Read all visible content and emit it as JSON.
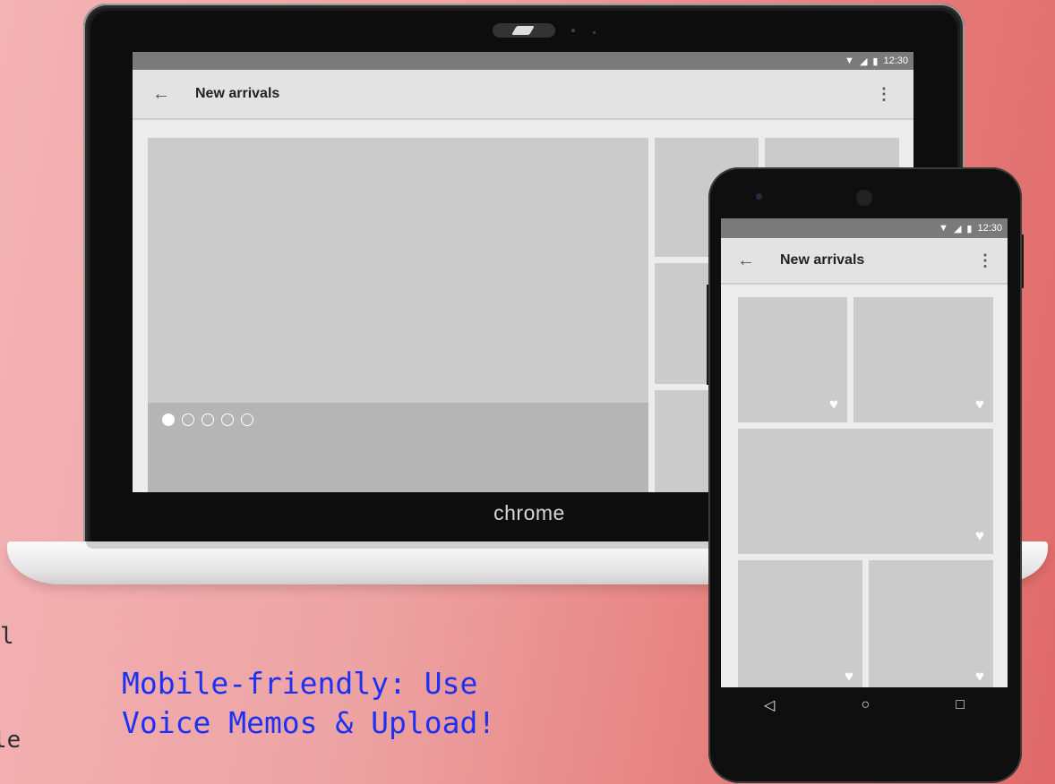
{
  "laptop": {
    "brand": "chrome",
    "status_time": "12:30",
    "toolbar_title": "New arrivals",
    "back_icon": "arrow-left-icon",
    "menu_icon": "more-vert-icon",
    "carousel_dots": 5,
    "carousel_active_index": 0
  },
  "phone": {
    "status_time": "12:30",
    "toolbar_title": "New arrivals",
    "back_icon": "arrow-left-icon",
    "menu_icon": "more-vert-icon",
    "nav": [
      "back-triangle-icon",
      "home-circle-icon",
      "recents-square-icon"
    ]
  },
  "overlay": {
    "line1": "Mobile-friendly: Use",
    "line2": "Voice Memos & Upload!",
    "color": "#1d31f4"
  },
  "edge_text": {
    "fragment1": "l",
    "fragment2": "le"
  }
}
